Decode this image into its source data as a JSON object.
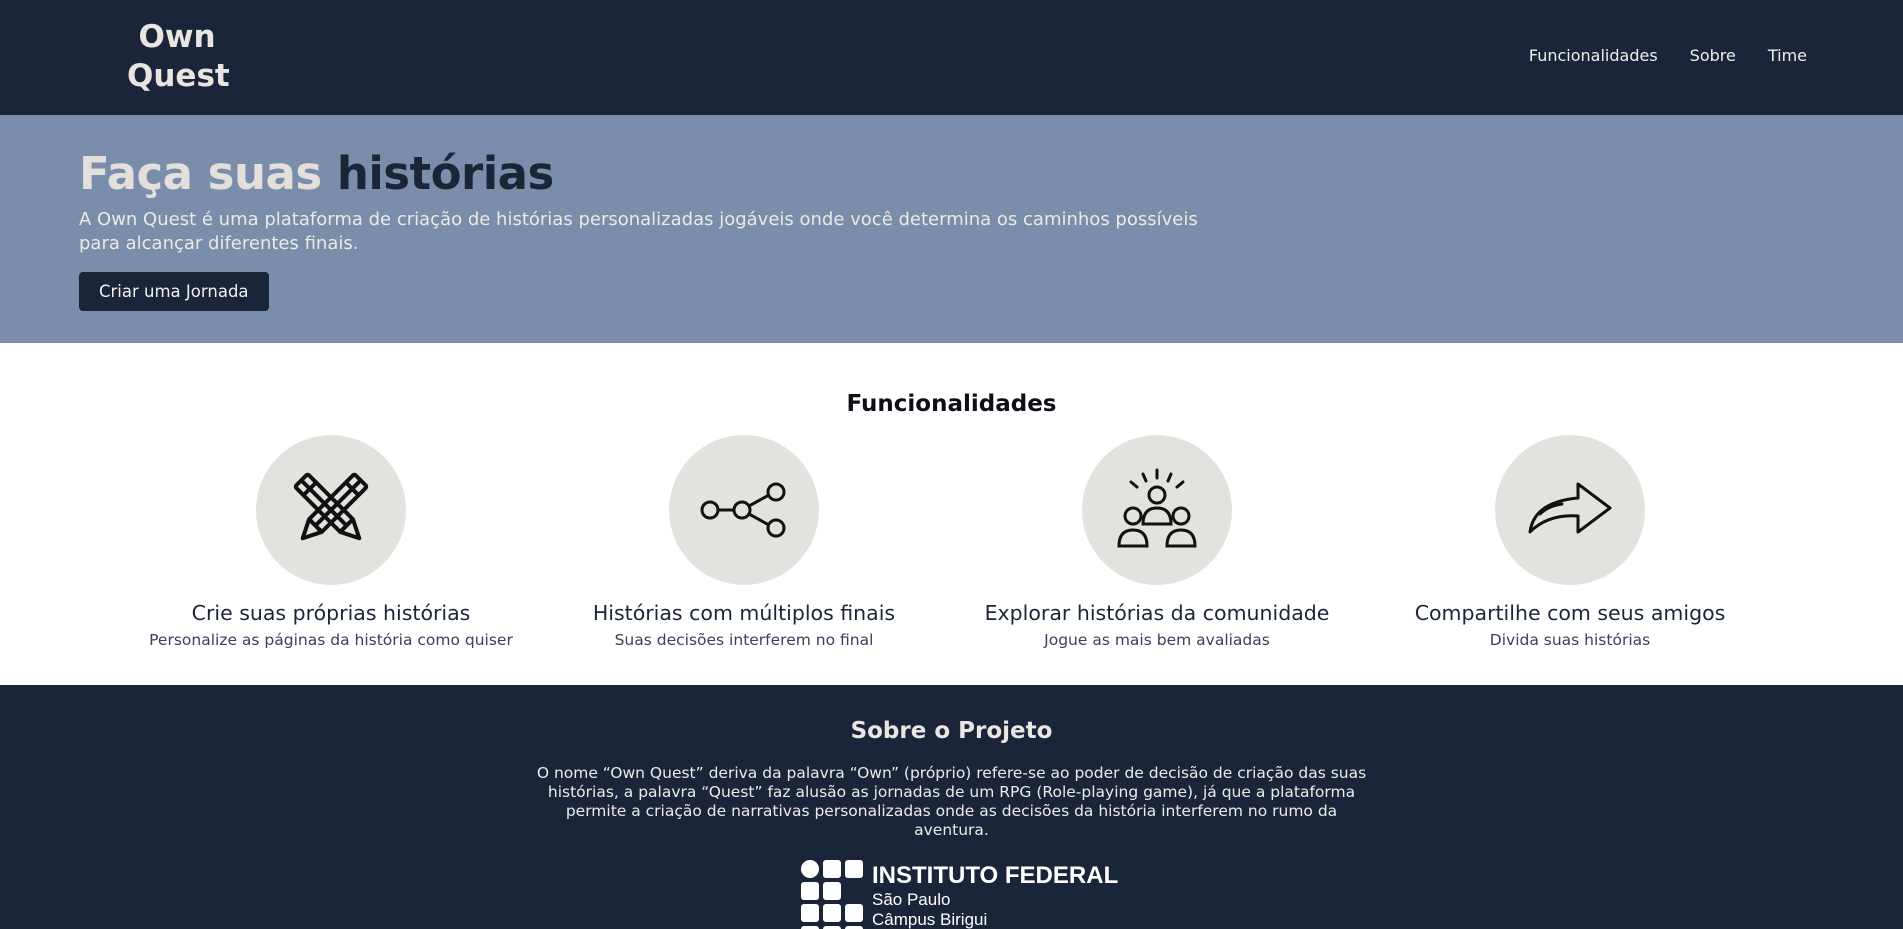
{
  "header": {
    "logo_line1": "Own",
    "logo_line2": "Quest",
    "nav": [
      "Funcionalidades",
      "Sobre",
      "Time"
    ]
  },
  "hero": {
    "title_light": "Faça suas",
    "title_dark": "histórias",
    "description": "A Own Quest é uma plataforma de criação de histórias personalizadas jogáveis onde você determina os caminhos possíveis para alcançar diferentes finais.",
    "button_label": "Criar uma Jornada"
  },
  "features": {
    "title": "Funcionalidades",
    "items": [
      {
        "icon": "pencils-icon",
        "title": "Crie suas próprias histórias",
        "subtitle": "Personalize as páginas da história como quiser"
      },
      {
        "icon": "branch-icon",
        "title": "Histórias com múltiplos finais",
        "subtitle": "Suas decisões interferem no final"
      },
      {
        "icon": "community-icon",
        "title": "Explorar histórias da comunidade",
        "subtitle": "Jogue as mais bem avaliadas"
      },
      {
        "icon": "share-arrow-icon",
        "title": "Compartilhe com seus amigos",
        "subtitle": "Divida suas histórias"
      }
    ]
  },
  "about": {
    "title": "Sobre o Projeto",
    "text": "O nome “Own Quest” deriva da palavra “Own” (próprio) refere-se ao poder de decisão de criação das suas histórias, a palavra “Quest” faz alusão as jornadas de um RPG (Role-playing game), já que a plataforma permite a criação de narrativas personalizadas onde as decisões da história interferem no rumo da aventura.",
    "logo_name": "INSTITUTO FEDERAL",
    "logo_state": "São Paulo",
    "logo_campus": "Câmpus Birigui"
  },
  "colors": {
    "navy": "#1b2539",
    "hero_bg": "#7a8daa",
    "circle_bg": "#e3e2de"
  }
}
